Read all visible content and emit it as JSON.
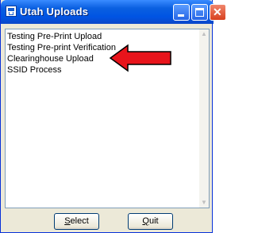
{
  "window": {
    "title": "Utah Uploads",
    "colors": {
      "titlebar": "#0054e3",
      "frame": "#ece9d8",
      "close_button": "#d8411f",
      "annotation_arrow": "#e8141b"
    }
  },
  "list": {
    "items": [
      {
        "label": "Testing Pre-Print Upload"
      },
      {
        "label": "Testing Pre-print Verification"
      },
      {
        "label": "Clearinghouse Upload"
      },
      {
        "label": "SSID Process"
      }
    ]
  },
  "buttons": {
    "select": {
      "mnemonic": "S",
      "rest": "elect"
    },
    "quit": {
      "mnemonic": "Q",
      "rest": "uit"
    }
  },
  "icons": {
    "app": "app-window-icon",
    "minimize": "minimize-icon",
    "maximize": "maximize-icon",
    "close": "close-icon",
    "annotation": "red-arrow-icon"
  }
}
